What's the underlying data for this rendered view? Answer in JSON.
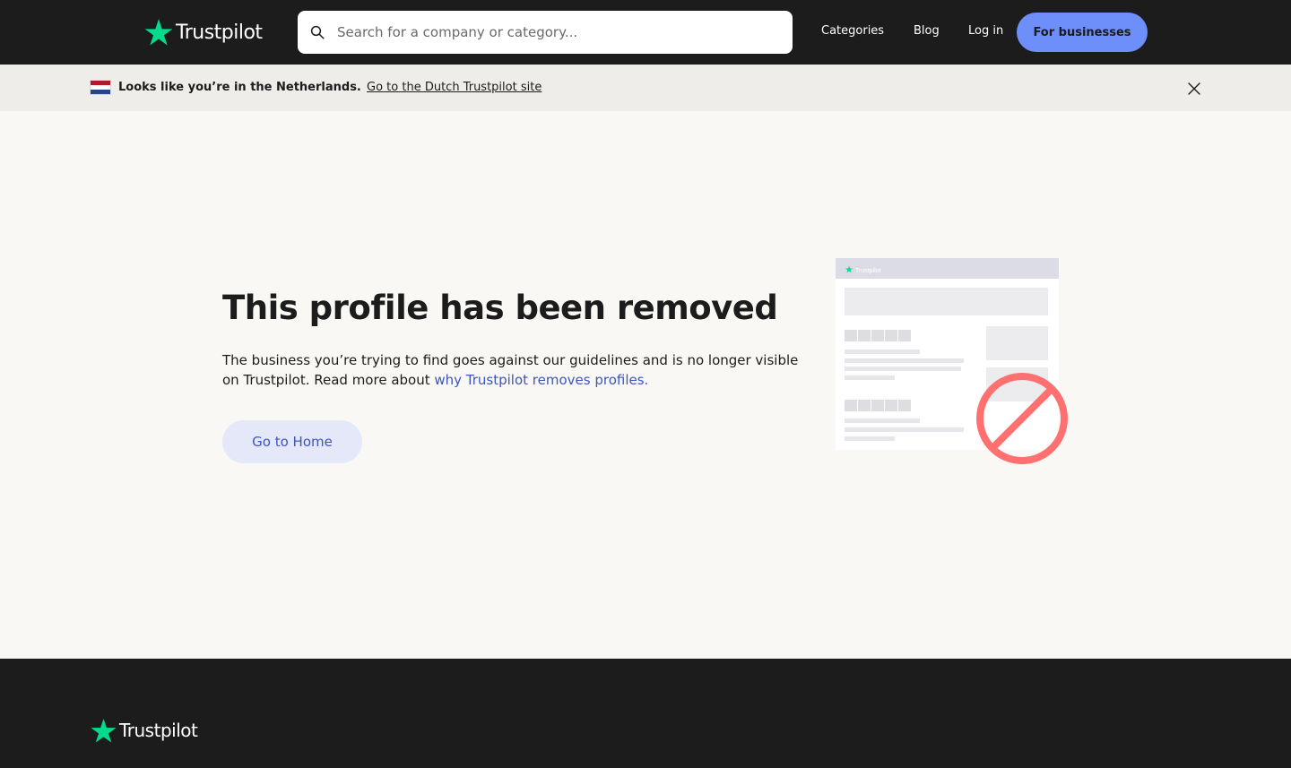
{
  "header": {
    "logo_text": "Trustpilot",
    "search": {
      "placeholder": "Search for a company or category..."
    },
    "nav": [
      {
        "label": "Categories"
      },
      {
        "label": "Blog"
      },
      {
        "label": "Log in"
      }
    ],
    "business_button": "For businesses"
  },
  "banner": {
    "message": "Looks like you’re in the Netherlands.",
    "link": "Go to the Dutch Trustpilot site",
    "flag": "netherlands-flag-icon"
  },
  "main": {
    "title": "This profile has been removed",
    "description": "The business you’re trying to find goes against our guidelines and is no longer visible on Trustpilot. Read more about",
    "description_link": "why Trustpilot removes profiles.",
    "home_button": "Go to Home",
    "illustration_label": "Trustpilot"
  },
  "footer": {
    "logo_text": "Trustpilot"
  },
  "colors": {
    "brand_green": "#04da8d",
    "business_button": "#6e8ffa",
    "link_blue": "#3c57bc",
    "block_red": "#ff7070"
  }
}
